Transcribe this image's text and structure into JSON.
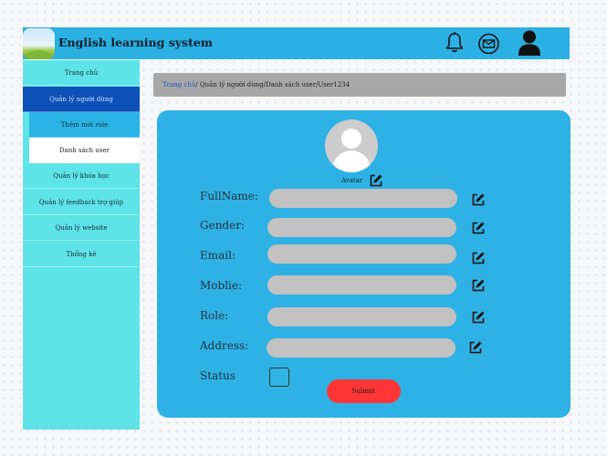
{
  "header": {
    "title": "English learning system",
    "icons": [
      "bell-icon",
      "mail-icon",
      "user-icon"
    ]
  },
  "sidebar": {
    "items": [
      {
        "label": "Trang chủ"
      },
      {
        "label": "Quản lý người dùng"
      },
      {
        "label": "Thêm mới role"
      },
      {
        "label": "Danh sách user"
      },
      {
        "label": "Quản lý khóa học"
      },
      {
        "label": "Quản lý feedback trợ giúp"
      },
      {
        "label": "Quản lý website"
      },
      {
        "label": "Thống kê"
      }
    ]
  },
  "breadcrumb": {
    "home": "Trang chủ",
    "rest": "/ Quản lý người dùng/Danh sách user/User1234"
  },
  "form": {
    "avatar_label": "Avatar",
    "fields": [
      {
        "label": "FullName:",
        "value": ""
      },
      {
        "label": "Gender:",
        "value": ""
      },
      {
        "label": "Email:",
        "value": ""
      },
      {
        "label": "Moblie:",
        "value": ""
      },
      {
        "label": "Role:",
        "value": ""
      },
      {
        "label": "Address:",
        "value": ""
      }
    ],
    "status_label": "Status",
    "status_checked": false,
    "submit_label": "Submit"
  },
  "colors": {
    "header_bg": "#2ab0e2",
    "sidebar_bg": "#5de3e8",
    "active_item": "#0d50b8",
    "panel_bg": "#2eb2e5",
    "input_bg": "#c2c2c2",
    "submit_bg": "#ff3535"
  }
}
